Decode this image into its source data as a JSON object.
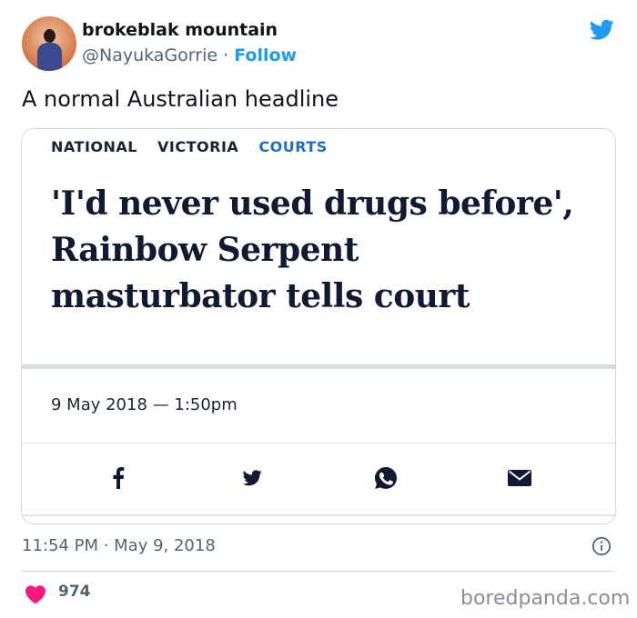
{
  "author": {
    "display_name": "brokeblak mountain",
    "handle": "@NayukaGorrie",
    "separator": "·",
    "follow_label": "Follow"
  },
  "tweet": {
    "text": "A normal Australian headline",
    "timestamp": "11:54 PM · May 9, 2018",
    "likes": "974"
  },
  "article": {
    "sections": [
      "NATIONAL",
      "VICTORIA",
      "COURTS"
    ],
    "headline_lines": [
      "'I'd never used drugs before',",
      "Rainbow Serpent",
      "masturbator tells court"
    ],
    "dateline": "9 May 2018 — 1:50pm",
    "share_icons": [
      "facebook-icon",
      "twitter-icon",
      "whatsapp-icon",
      "email-icon"
    ]
  },
  "watermark": "boredpanda.com",
  "colors": {
    "twitter_blue": "#1d9bf0",
    "heart_pink": "#f91880",
    "secondary_text": "#536471",
    "headline_navy": "#111a33",
    "section_blue": "#1f6fbf"
  }
}
